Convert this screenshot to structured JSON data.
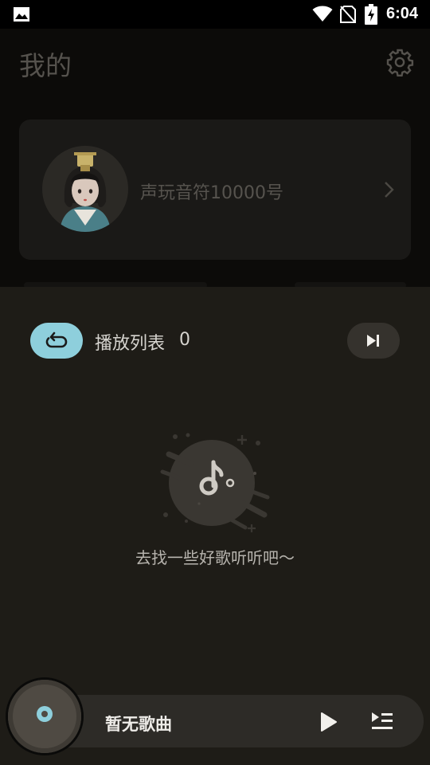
{
  "status_bar": {
    "time": "6:04",
    "icons": [
      "gallery-icon",
      "wifi-icon",
      "no-sim-icon",
      "battery-charging-icon"
    ]
  },
  "header": {
    "title": "我的",
    "settings_icon": "gear-icon"
  },
  "profile": {
    "username": "声玩音符10000号",
    "avatar": "avatar-illustration",
    "chevron_icon": "chevron-right-icon"
  },
  "playlist": {
    "label": "播放列表",
    "count": "0",
    "loop_icon": "repeat-icon",
    "next_icon": "skip-next-icon",
    "empty_message": "去找一些好歌听听吧～"
  },
  "player": {
    "song_title": "暂无歌曲",
    "play_icon": "play-icon",
    "queue_icon": "queue-play-icon"
  },
  "colors": {
    "accent": "#8ecfdc",
    "background": "#0c0b09",
    "sheet": "#1e1c17",
    "card": "#1a1917"
  }
}
